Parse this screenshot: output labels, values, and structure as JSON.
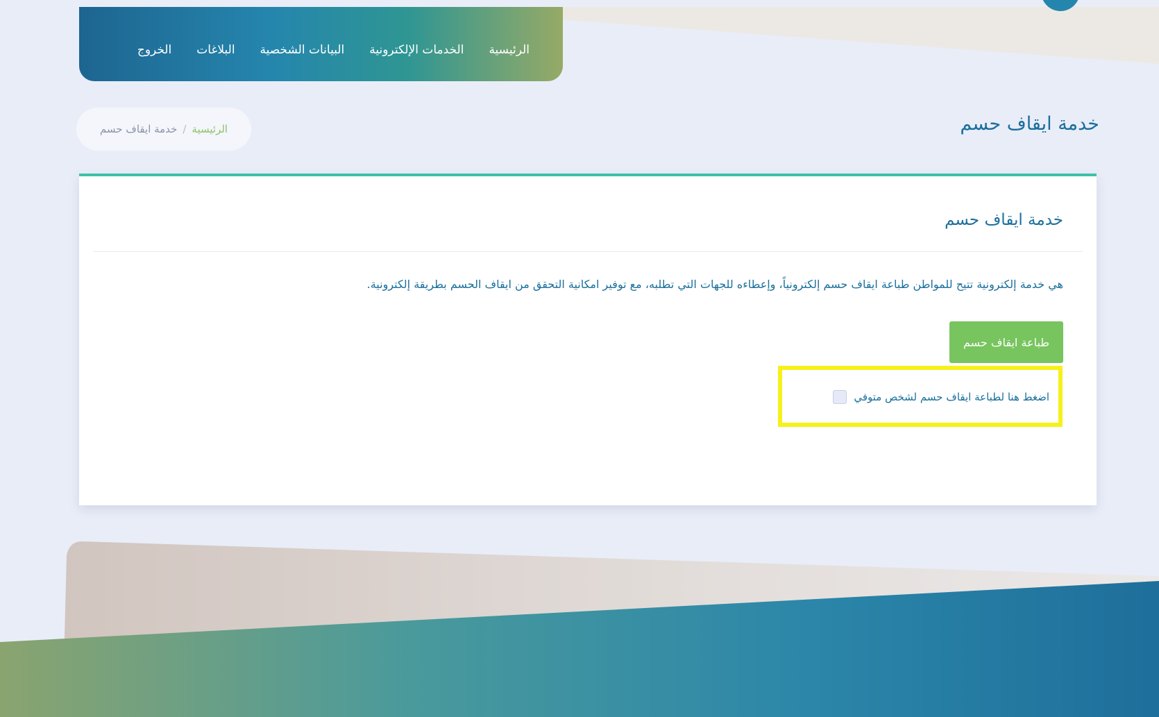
{
  "nav": {
    "items": [
      "الرئيسية",
      "الخدمات الإلكترونية",
      "البيانات الشخصية",
      "البلاغات",
      "الخروج"
    ]
  },
  "breadcrumb": {
    "home": "الرئيسية",
    "separator": "/",
    "current": "خدمة ايقاف حسم"
  },
  "page": {
    "title": "خدمة ايقاف حسم"
  },
  "card": {
    "title": "خدمة ايقاف حسم",
    "description": "هي خدمة إلكترونية تتيح للمواطن طباعة ايقاف حسم إلكترونياً، وإعطاءه للجهات التي تطلبه، مع توفير امكانية التحقق من ايقاف الحسم بطريقة إلكترونية.",
    "print_button": "طباعة ايقاف حسم",
    "checkbox_label": "اضغط هنا لطباعة ايقاف حسم لشخص متوفي"
  },
  "colors": {
    "accent_blue": "#1a6f9b",
    "accent_green": "#78c45f",
    "card_border": "#3fc1a8",
    "highlight": "#f5f11a"
  }
}
